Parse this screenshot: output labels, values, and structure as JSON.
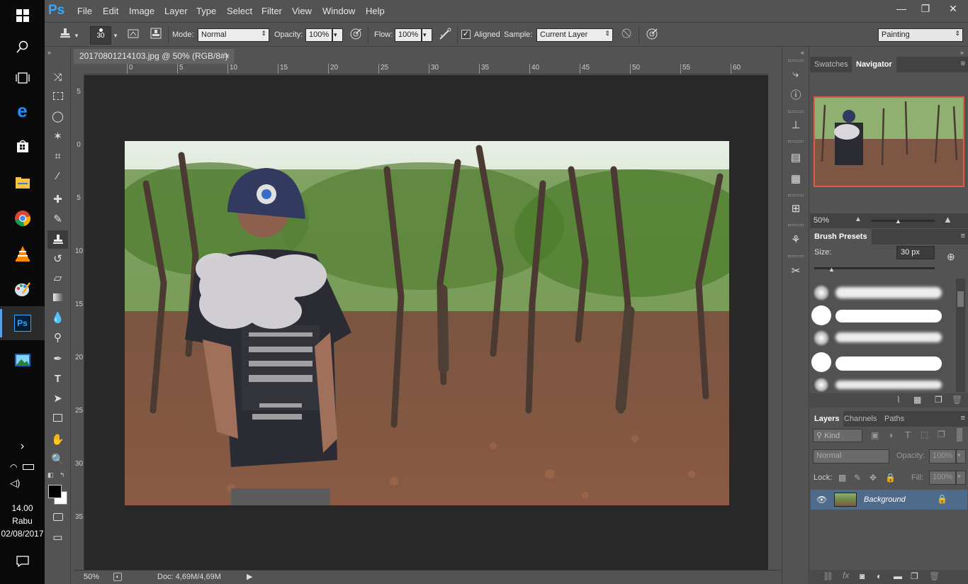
{
  "taskbar": {
    "clock": {
      "time": "14.00",
      "day": "Rabu",
      "date": "02/08/2017"
    }
  },
  "app": {
    "logo": "Ps",
    "menu": [
      "File",
      "Edit",
      "Image",
      "Layer",
      "Type",
      "Select",
      "Filter",
      "View",
      "Window",
      "Help"
    ],
    "window_controls": {
      "minimize": "—",
      "maximize": "❐",
      "close": "✕"
    }
  },
  "options": {
    "brush_size": "30",
    "mode_label": "Mode:",
    "mode_value": "Normal",
    "opacity_label": "Opacity:",
    "opacity_value": "100%",
    "flow_label": "Flow:",
    "flow_value": "100%",
    "aligned_label": "Aligned",
    "sample_label": "Sample:",
    "sample_value": "Current Layer",
    "workspace": "Painting"
  },
  "document": {
    "tab_title": "20170801214103.jpg @ 50% (RGB/8#)",
    "tab_close": "×",
    "ruler_top": [
      "0",
      "5",
      "10",
      "15",
      "20",
      "25",
      "30",
      "35",
      "40",
      "45",
      "50",
      "55",
      "60"
    ],
    "ruler_left": [
      "5",
      "0",
      "5",
      "10",
      "15",
      "20",
      "25",
      "30",
      "35"
    ],
    "zoom": "50%",
    "doc_info": "Doc: 4,69M/4,69M"
  },
  "navigator": {
    "tabs": [
      "Swatches",
      "Navigator"
    ],
    "zoom": "50%"
  },
  "brush_presets": {
    "title": "Brush Presets",
    "size_label": "Size:",
    "size_value": "30 px"
  },
  "layers": {
    "tabs": [
      "Layers",
      "Channels",
      "Paths"
    ],
    "kind": "Kind",
    "blend_mode": "Normal",
    "opacity_label": "Opacity:",
    "opacity_value": "100%",
    "lock_label": "Lock:",
    "fill_label": "Fill:",
    "fill_value": "100%",
    "layer_name": "Background"
  },
  "colors": {
    "ps_blue": "#31a8ff",
    "canvas_bg": "#282828",
    "panel_bg": "#535353",
    "selected_layer": "#4f6b8c",
    "navigator_frame": "#e05a4a"
  }
}
